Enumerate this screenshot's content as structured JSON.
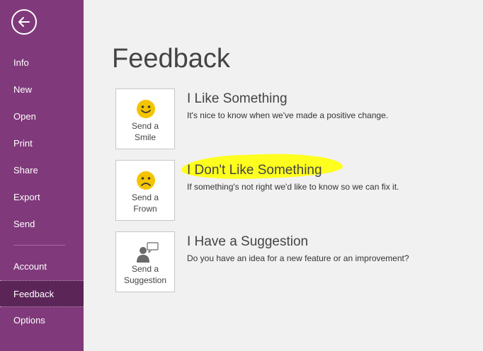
{
  "sidebar": {
    "items": [
      {
        "label": "Info"
      },
      {
        "label": "New"
      },
      {
        "label": "Open"
      },
      {
        "label": "Print"
      },
      {
        "label": "Share"
      },
      {
        "label": "Export"
      },
      {
        "label": "Send"
      },
      {
        "label": "Account"
      },
      {
        "label": "Feedback"
      },
      {
        "label": "Options"
      }
    ],
    "active": "Feedback"
  },
  "main": {
    "title": "Feedback",
    "options": [
      {
        "tile_label": "Send a Smile",
        "icon": "smile-icon",
        "title": "I Like Something",
        "description": "It's nice to know when we've made a positive change."
      },
      {
        "tile_label": "Send a Frown",
        "icon": "frown-icon",
        "title": "I Don't Like Something",
        "description": "If something's not right we'd like to know so we can fix it."
      },
      {
        "tile_label": "Send a Suggestion",
        "icon": "suggestion-icon",
        "title": "I Have a Suggestion",
        "description": "Do you have an idea for a new feature or an improvement?"
      }
    ]
  },
  "colors": {
    "sidebar": "#80397b",
    "sidebar_active": "#5c2558",
    "highlight": "#ffff1f",
    "emoji": "#f5c400"
  }
}
